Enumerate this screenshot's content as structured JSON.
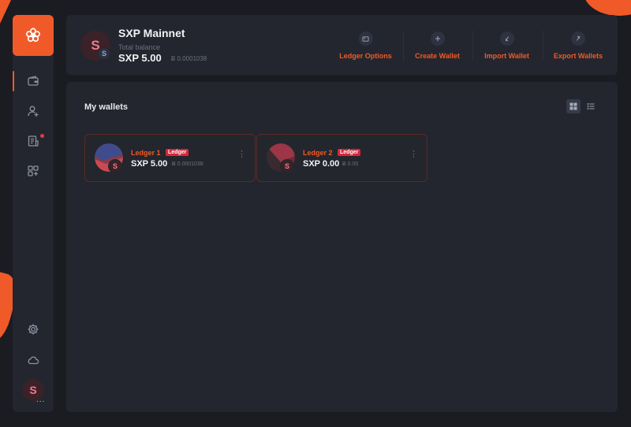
{
  "colors": {
    "accent": "#f05a28",
    "background": "#1a1c22",
    "panel": "#23262e",
    "tag": "#d6283a"
  },
  "sidebar": {
    "logo": "logo-icon",
    "items": [
      {
        "icon": "wallet-icon",
        "active": true
      },
      {
        "icon": "add-user-icon",
        "active": false
      },
      {
        "icon": "transactions-icon",
        "active": false,
        "notification": true
      },
      {
        "icon": "apps-icon",
        "active": false
      }
    ],
    "settings_icon": "gear-icon",
    "cloud_icon": "cloud-icon",
    "avatar_letter": "S",
    "avatar_more": "..."
  },
  "header": {
    "avatar_letter": "S",
    "avatar_badge": "S",
    "network_name": "SXP Mainnet",
    "total_label": "Total balance",
    "total_value": "SXP 5.00",
    "total_btc": "Ƀ 0.0001038",
    "actions": [
      {
        "label": "Ledger Options",
        "icon": "ledger-icon"
      },
      {
        "label": "Create Wallet",
        "icon": "plus-icon"
      },
      {
        "label": "Import Wallet",
        "icon": "import-icon"
      },
      {
        "label": "Export Wallets",
        "icon": "export-icon"
      }
    ]
  },
  "main": {
    "title": "My wallets",
    "view_modes": [
      "grid-view-icon",
      "list-view-icon"
    ],
    "active_view": "grid",
    "wallets": [
      {
        "name": "Ledger 1",
        "tag": "Ledger",
        "balance": "SXP 5.00",
        "btc": "Ƀ 0.0001038",
        "badge": "S"
      },
      {
        "name": "Ledger 2",
        "tag": "Ledger",
        "balance": "SXP 0.00",
        "btc": "Ƀ 0.00",
        "badge": "S"
      }
    ]
  }
}
